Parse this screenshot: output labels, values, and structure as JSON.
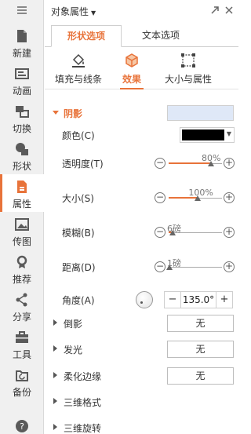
{
  "rail": {
    "items": [
      {
        "label": "新建",
        "icon": "new-doc-icon"
      },
      {
        "label": "动画",
        "icon": "animation-icon"
      },
      {
        "label": "切换",
        "icon": "transition-icon"
      },
      {
        "label": "形状",
        "icon": "shape-icon"
      },
      {
        "label": "属性",
        "icon": "property-icon"
      },
      {
        "label": "传图",
        "icon": "upload-image-icon"
      },
      {
        "label": "推荐",
        "icon": "recommend-icon"
      },
      {
        "label": "分享",
        "icon": "share-icon"
      },
      {
        "label": "工具",
        "icon": "toolbox-icon"
      },
      {
        "label": "备份",
        "icon": "backup-icon"
      }
    ],
    "active": "属性",
    "accent": "#e8733a"
  },
  "panel": {
    "title": "对象属性",
    "tabs": [
      "形状选项",
      "文本选项"
    ],
    "active_tab": "形状选项",
    "subtabs": [
      "填充与线条",
      "效果",
      "大小与属性"
    ],
    "active_subtab": "效果",
    "shadow": {
      "section": "阴影",
      "color_label": "颜色(C)",
      "color_value": "#000000",
      "transparency_label": "透明度(T)",
      "transparency_value": "80%",
      "transparency_level": 0.8,
      "size_label": "大小(S)",
      "size_value": "100%",
      "size_level": 0.55,
      "blur_label": "模糊(B)",
      "blur_value": "6磅",
      "blur_level": 0.08,
      "distance_label": "距离(D)",
      "distance_value": "1磅",
      "distance_level": 0.02,
      "angle_label": "角度(A)",
      "angle_value": "135.0°"
    },
    "collapsed_sections": [
      {
        "label": "倒影",
        "value": "无"
      },
      {
        "label": "发光",
        "value": "无"
      },
      {
        "label": "柔化边缘",
        "value": "无"
      },
      {
        "label": "三维格式",
        "value": ""
      },
      {
        "label": "三维旋转",
        "value": ""
      }
    ],
    "stepper_minus": "−",
    "stepper_plus": "+"
  }
}
